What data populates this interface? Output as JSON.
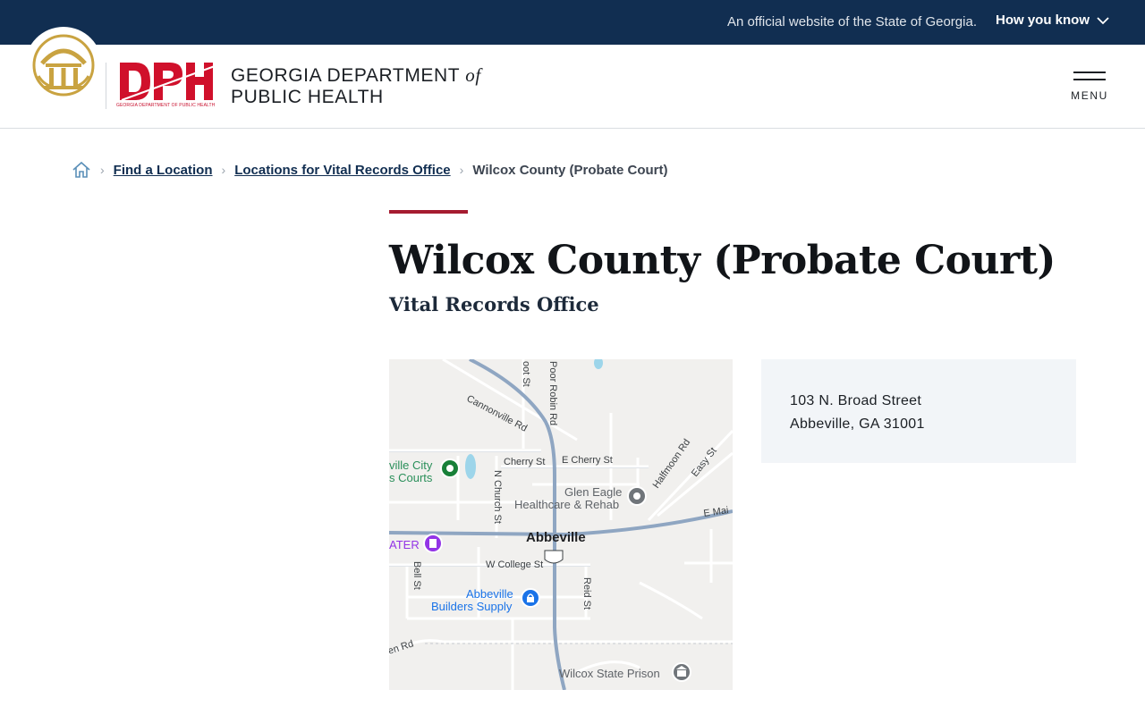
{
  "banner": {
    "official_text": "An official website of the State of Georgia.",
    "how_you_know": "How you know"
  },
  "header": {
    "logo_small_text": "GEORGIA DEPARTMENT OF PUBLIC HEALTH",
    "dept_line1": "GEORGIA DEPARTMENT ",
    "dept_of": "of",
    "dept_line2": "PUBLIC HEALTH",
    "menu_label": "MENU"
  },
  "breadcrumb": {
    "items": [
      {
        "label": "Find a Location"
      },
      {
        "label": "Locations for Vital Records Office"
      }
    ],
    "current": "Wilcox County (Probate Court)"
  },
  "page": {
    "title": "Wilcox County (Probate Court)",
    "subtitle": "Vital Records Office"
  },
  "map": {
    "labels": {
      "cannonville": "Cannonville Rd",
      "poor_robin": "Poor Robin Rd",
      "foot_st": "oot St",
      "cherry_st": "Cherry St",
      "e_cherry_st": "E Cherry St",
      "halfmoon": "Halfmoon Rd",
      "easy_st": "Easy St",
      "city_courts_1": "ville City",
      "city_courts_2": "s Courts",
      "n_church": "N Church St",
      "glen_eagle_1": "Glen Eagle",
      "glen_eagle_2": "Healthcare & Rehab",
      "e_main": "E Mai",
      "abbeville": "Abbeville",
      "theater": "ATER",
      "bell_st": "Bell St",
      "w_college": "W College St",
      "route": "129",
      "builders_1": "Abbeville",
      "builders_2": "Builders Supply",
      "reid_st": "Reid St",
      "en_rd": "en Rd",
      "prison": "Wilcox State Prison"
    }
  },
  "address": {
    "line1": "103 N. Broad Street",
    "line2": "Abbeville, GA 31001"
  }
}
